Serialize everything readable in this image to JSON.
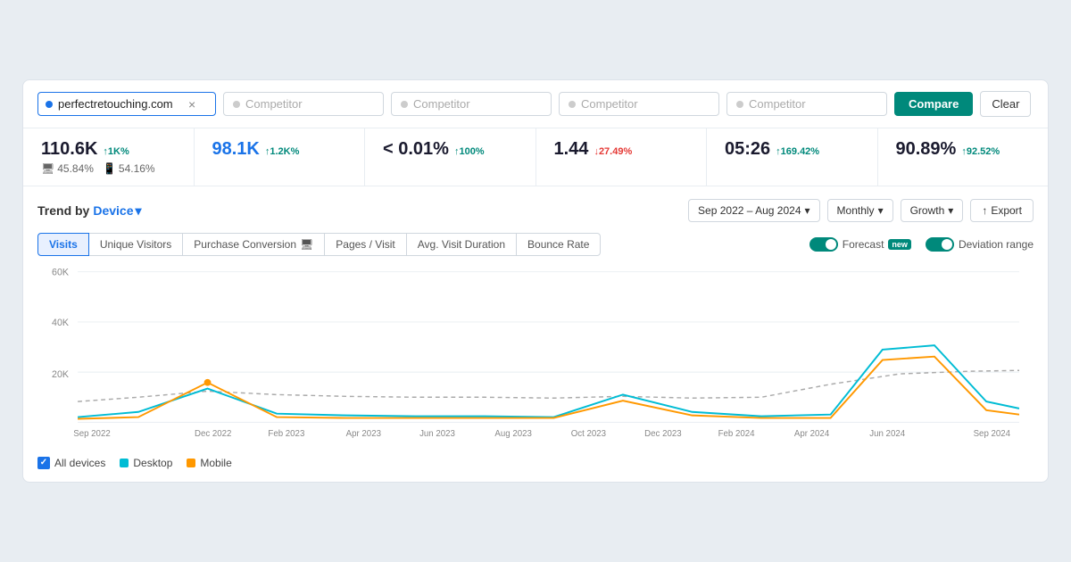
{
  "searchbar": {
    "domain": "perfectretouching.com",
    "close_label": "×",
    "competitor_placeholder": "Competitor",
    "compare_label": "Compare",
    "clear_label": "Clear"
  },
  "metrics": [
    {
      "value": "110.6K",
      "badge": "↑1K%",
      "badge_type": "up",
      "sub1_icon": "desktop",
      "sub1": "45.84%",
      "sub2_icon": "mobile",
      "sub2": "54.16%"
    },
    {
      "value": "98.1K",
      "badge": "↑1.2K%",
      "badge_type": "up",
      "sub1": "",
      "sub2": ""
    },
    {
      "value": "< 0.01%",
      "badge": "↑100%",
      "badge_type": "up",
      "sub1": "",
      "sub2": ""
    },
    {
      "value": "1.44",
      "badge": "↓27.49%",
      "badge_type": "down",
      "sub1": "",
      "sub2": ""
    },
    {
      "value": "05:26",
      "badge": "↑169.42%",
      "badge_type": "up",
      "sub1": "",
      "sub2": ""
    },
    {
      "value": "90.89%",
      "badge": "↑92.52%",
      "badge_type": "up",
      "sub1": "",
      "sub2": ""
    }
  ],
  "trend": {
    "title": "Trend by",
    "device_label": "Device",
    "date_range": "Sep 2022 – Aug 2024",
    "monthly_label": "Monthly",
    "growth_label": "Growth",
    "export_label": "Export"
  },
  "tabs": {
    "items": [
      {
        "label": "Visits",
        "active": true
      },
      {
        "label": "Unique Visitors",
        "active": false
      },
      {
        "label": "Purchase Conversion",
        "active": false
      },
      {
        "label": "Pages / Visit",
        "active": false
      },
      {
        "label": "Avg. Visit Duration",
        "active": false
      },
      {
        "label": "Bounce Rate",
        "active": false
      }
    ]
  },
  "forecast": {
    "label": "Forecast",
    "new_badge": "new",
    "deviation_label": "Deviation range"
  },
  "chart": {
    "y_labels": [
      "60K",
      "40K",
      "20K",
      ""
    ],
    "x_labels": [
      "Sep 2022",
      "Dec 2022",
      "Feb 2023",
      "Apr 2023",
      "Jun 2023",
      "Aug 2023",
      "Oct 2023",
      "Dec 2023",
      "Feb 2024",
      "Apr 2024",
      "Jun 2024",
      "Sep 2024"
    ]
  },
  "legend": {
    "items": [
      {
        "label": "All devices",
        "color": "#1a73e8",
        "type": "check"
      },
      {
        "label": "Desktop",
        "color": "#00bcd4",
        "type": "dot"
      },
      {
        "label": "Mobile",
        "color": "#ff9800",
        "type": "dot"
      }
    ]
  }
}
